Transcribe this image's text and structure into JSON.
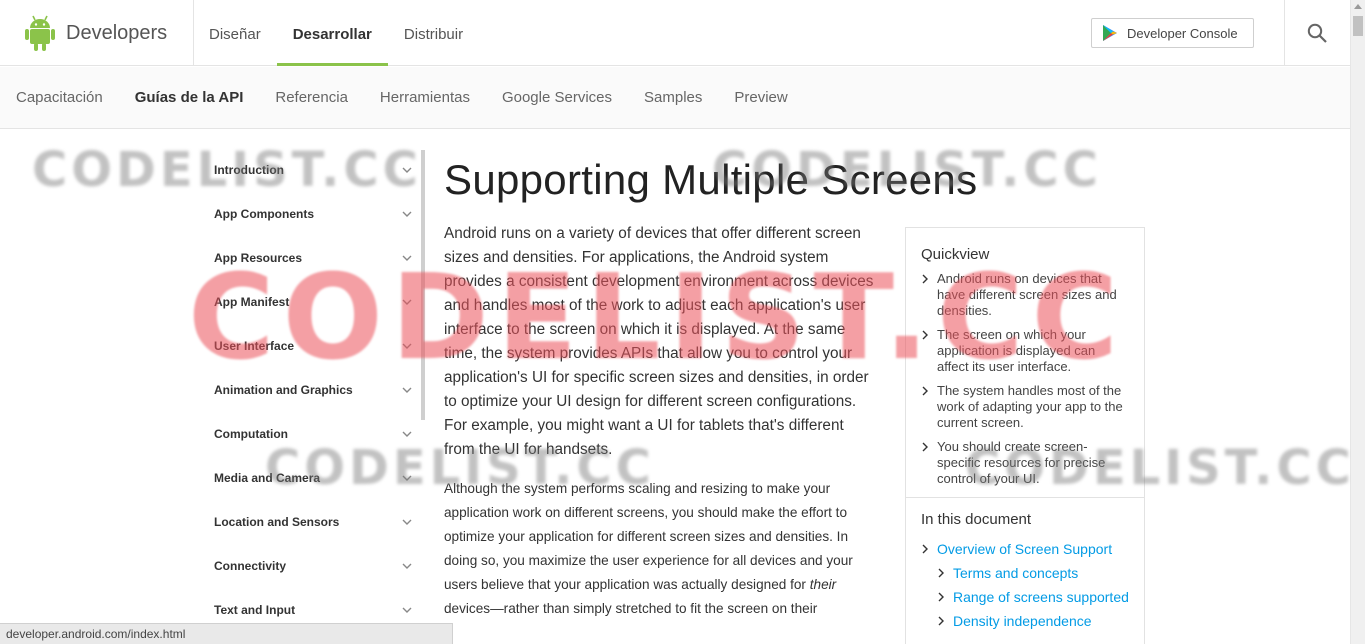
{
  "header": {
    "brand": "Developers",
    "nav": [
      {
        "label": "Diseñar",
        "active": false
      },
      {
        "label": "Desarrollar",
        "active": true
      },
      {
        "label": "Distribuir",
        "active": false
      }
    ],
    "console_button": "Developer Console",
    "accent_color": "#8bc34a",
    "icons": [
      "android-logo-icon",
      "play-triangle-icon",
      "search-icon"
    ]
  },
  "subnav": {
    "items": [
      {
        "label": "Capacitación",
        "active": false
      },
      {
        "label": "Guías de la API",
        "active": true
      },
      {
        "label": "Referencia",
        "active": false
      },
      {
        "label": "Herramientas",
        "active": false
      },
      {
        "label": "Google Services",
        "active": false
      },
      {
        "label": "Samples",
        "active": false
      },
      {
        "label": "Preview",
        "active": false
      }
    ]
  },
  "sidebar": {
    "items": [
      {
        "label": "Introduction"
      },
      {
        "label": "App Components"
      },
      {
        "label": "App Resources"
      },
      {
        "label": "App Manifest"
      },
      {
        "label": "User Interface"
      },
      {
        "label": "Animation and Graphics"
      },
      {
        "label": "Computation"
      },
      {
        "label": "Media and Camera"
      },
      {
        "label": "Location and Sensors"
      },
      {
        "label": "Connectivity"
      },
      {
        "label": "Text and Input"
      }
    ]
  },
  "main": {
    "title": "Supporting Multiple Screens",
    "lead": "Android runs on a variety of devices that offer different screen sizes and densities. For applications, the Android system provides a consistent development environment across devices and handles most of the work to adjust each application's user interface to the screen on which it is displayed. At the same time, the system provides APIs that allow you to control your application's UI for specific screen sizes and densities, in order to optimize your UI design for different screen configurations. For example, you might want a UI for tablets that's different from the UI for handsets.",
    "para_before": "Although the system performs scaling and resizing to make your application work on different screens, you should make the effort to optimize your application for different screen sizes and densities. In doing so, you maximize the user experience for all devices and your users believe that your application was actually designed for ",
    "para_em": "their",
    "para_after": " devices—rather than simply stretched to fit the screen on their"
  },
  "quickview": {
    "title": "Quickview",
    "items": [
      "Android runs on devices that have different screen sizes and densities.",
      "The screen on which your application is displayed can affect its user interface.",
      "The system handles most of the work of adapting your app to the current screen.",
      "You should create screen-specific resources for precise control of your UI."
    ],
    "doc_title": "In this document",
    "doc_links": [
      {
        "label": "Overview of Screen Support",
        "level": 1
      },
      {
        "label": "Terms and concepts",
        "level": 2
      },
      {
        "label": "Range of screens supported",
        "level": 2
      },
      {
        "label": "Density independence",
        "level": 2
      }
    ],
    "link_color": "#039be5"
  },
  "status_bar": {
    "url": "developer.android.com/index.html"
  },
  "watermarks": {
    "small": "CODELIST.CC",
    "big": "CODELIST.CC"
  }
}
